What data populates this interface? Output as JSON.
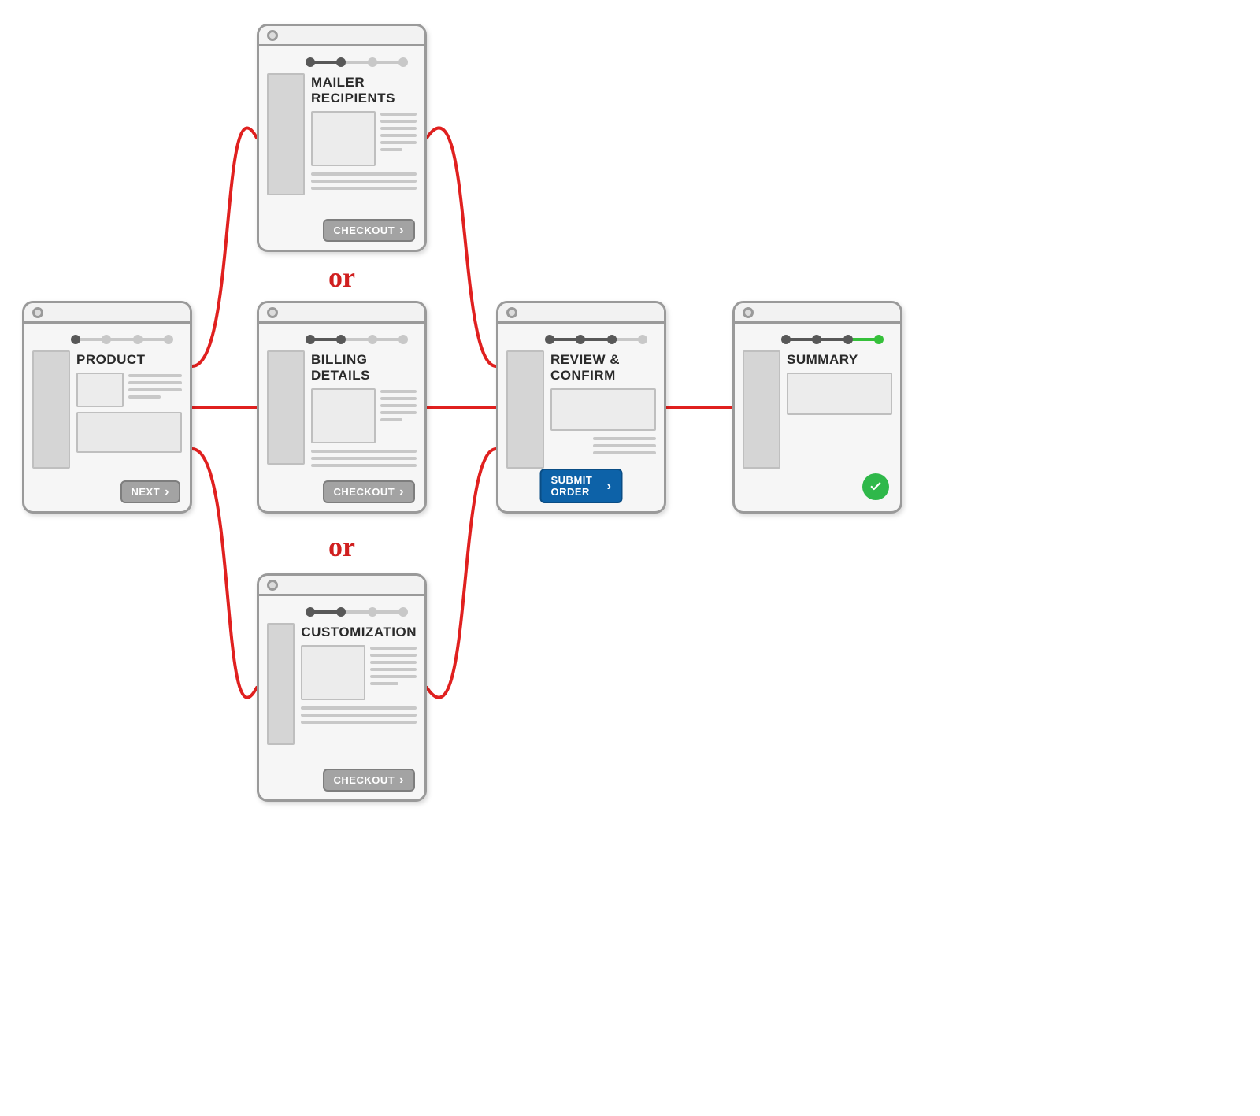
{
  "cards": {
    "product": {
      "title": "PRODUCT",
      "button": "NEXT"
    },
    "mailer": {
      "title": "MAILER RECIPIENTS",
      "button": "CHECKOUT"
    },
    "billing": {
      "title": "BILLING DETAILS",
      "button": "CHECKOUT"
    },
    "custom": {
      "title": "CUSTOMIZATION",
      "button": "CHECKOUT"
    },
    "review": {
      "title": "REVIEW & CONFIRM",
      "button": "SUBMIT ORDER"
    },
    "summary": {
      "title": "SUMMARY"
    }
  },
  "labels": {
    "or1": "or",
    "or2": "or"
  },
  "flow": {
    "description": "User flow: PRODUCT branches to one of MAILER RECIPIENTS / BILLING DETAILS / CUSTOMIZATION, each proceeds to REVIEW & CONFIRM, then SUMMARY.",
    "steps": [
      "PRODUCT",
      [
        "MAILER RECIPIENTS",
        "BILLING DETAILS",
        "CUSTOMIZATION"
      ],
      "REVIEW & CONFIRM",
      "SUMMARY"
    ]
  }
}
